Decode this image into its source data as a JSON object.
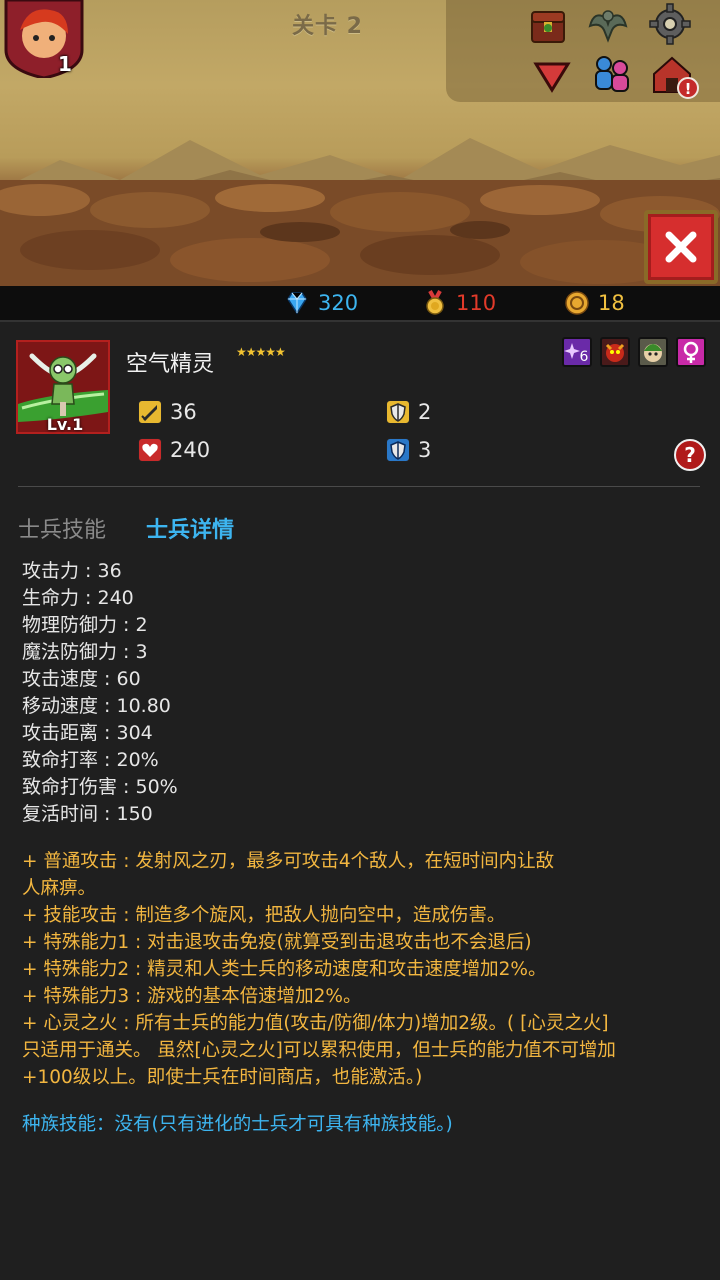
{
  "game": {
    "level_title": "关卡 2",
    "hero_level": "1"
  },
  "resources": {
    "gems": "320",
    "medals": "110",
    "coins": "18"
  },
  "unit": {
    "name": "空气精灵",
    "stars": "★★★★★",
    "level": "Lv.1",
    "tag_count": "6",
    "attack": "36",
    "hp": "240",
    "physical_defense": "2",
    "magic_defense": "3"
  },
  "tabs": {
    "skills": "士兵技能",
    "details": "士兵详情"
  },
  "attributes": [
    "攻击力 : 36",
    "生命力 : 240",
    "物理防御力 : 2",
    "魔法防御力 : 3",
    "攻击速度 : 60",
    "移动速度 : 10.80",
    "攻击距离 : 304",
    "致命打率 : 20%",
    "致命打伤害 : 50%",
    "复活时间 : 150"
  ],
  "abilities": [
    "+ 普通攻击 : 发射风之刃，最多可攻击4个敌人，在短时间内让敌",
    "人麻痹。",
    "+ 技能攻击 : 制造多个旋风，把敌人抛向空中，造成伤害。",
    "+ 特殊能力1 : 对击退攻击免疫(就算受到击退攻击也不会退后)",
    "+ 特殊能力2 : 精灵和人类士兵的移动速度和攻击速度增加2%。",
    "+ 特殊能力3 : 游戏的基本倍速增加2%。",
    "+ 心灵之火 : 所有士兵的能力值(攻击/防御/体力)增加2级。( [心灵之火]",
    "只适用于通关。 虽然[心灵之火]可以累积使用，但士兵的能力值不可增加",
    "+100级以上。即使士兵在时间商店，也能激活。)"
  ],
  "race_skill": "种族技能：没有(只有进化的士兵才可具有种族技能。)",
  "help_label": "?",
  "colors": {
    "accent_blue": "#3db5f0",
    "ability_orange": "#f2b640",
    "medal_red": "#e23a2a",
    "coin_gold": "#f0c040",
    "close_red": "#d62e2e"
  }
}
